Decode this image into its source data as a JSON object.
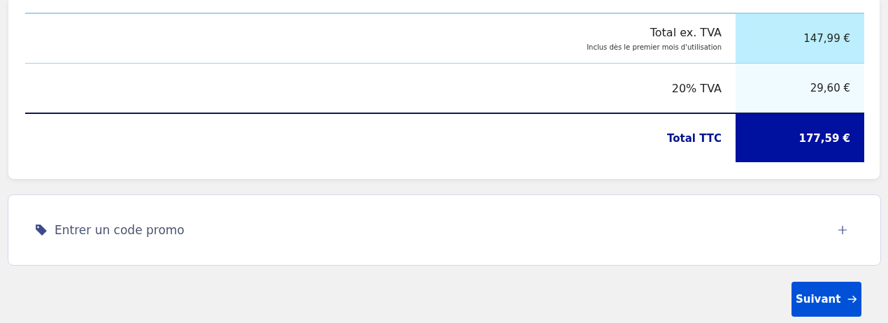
{
  "summary": {
    "rows": [
      {
        "kind": "subtotal",
        "label": "Total ex. TVA",
        "note": "Inclus dès le premier mois d'utilisation",
        "value": "147,99 €"
      },
      {
        "kind": "tax",
        "label": "20% TVA",
        "value": "29,60 €"
      },
      {
        "kind": "total",
        "label": "Total TTC",
        "value": "177,59 €"
      }
    ]
  },
  "promo": {
    "label": "Entrer un code promo"
  },
  "next_button": {
    "label": "Suivant"
  }
}
